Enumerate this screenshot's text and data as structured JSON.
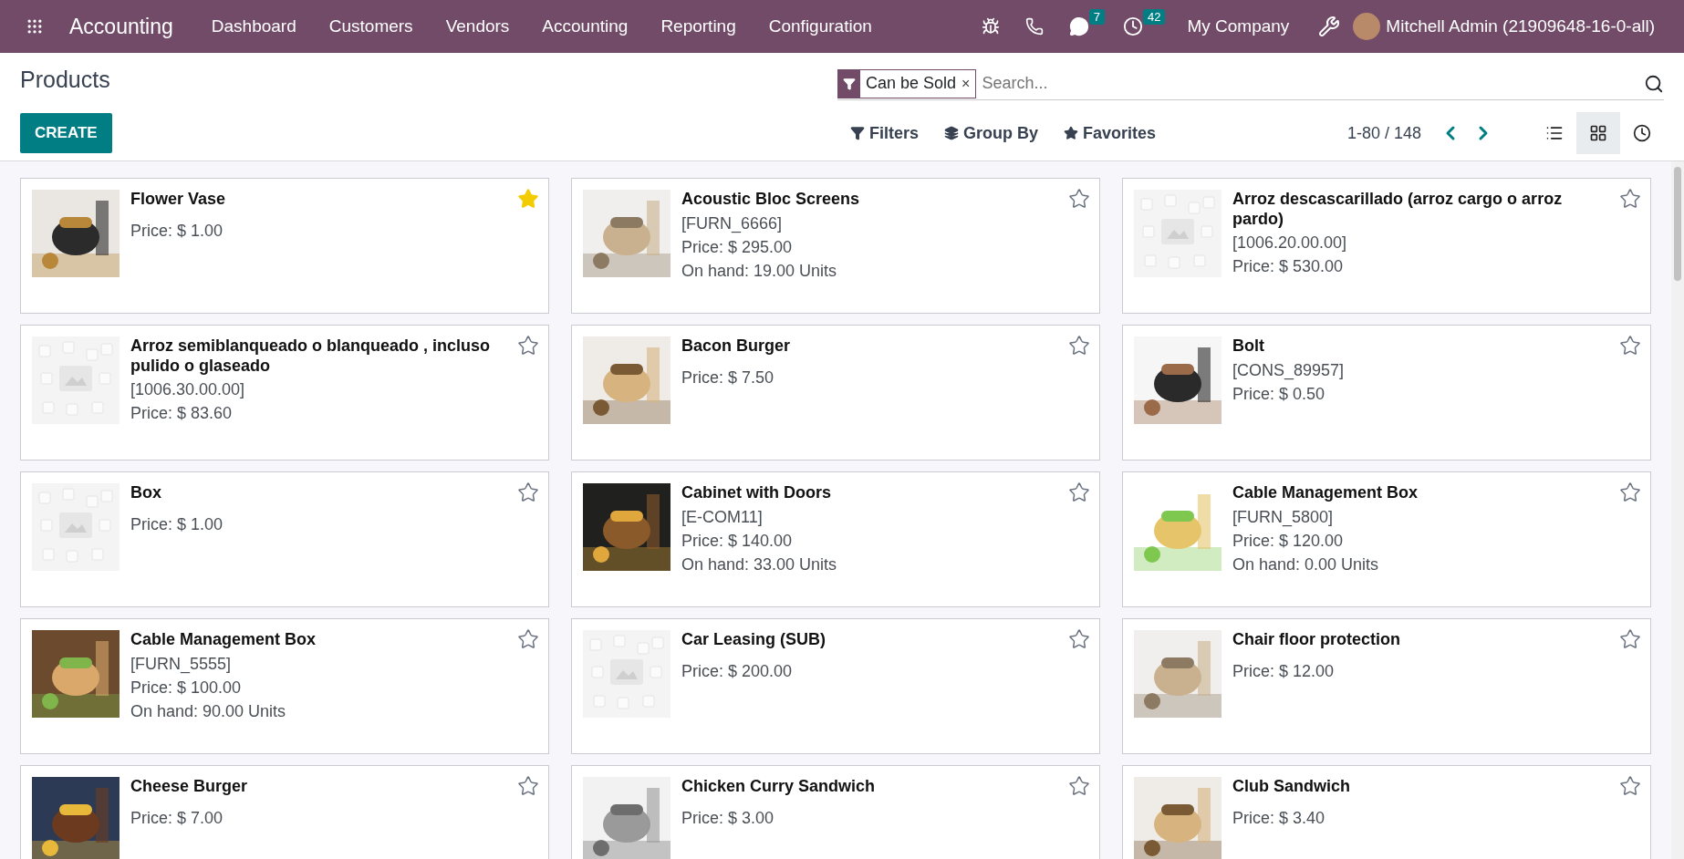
{
  "navbar": {
    "app_name": "Accounting",
    "menu": [
      "Dashboard",
      "Customers",
      "Vendors",
      "Accounting",
      "Reporting",
      "Configuration"
    ],
    "messages_badge": "7",
    "activities_badge": "42",
    "company": "My Company",
    "user": "Mitchell Admin (21909648-16-0-all)"
  },
  "control_panel": {
    "title": "Products",
    "create_label": "CREATE",
    "facet": {
      "label": "Can be Sold",
      "remove": "×"
    },
    "search": {
      "placeholder": "Search..."
    },
    "filters": [
      "Filters",
      "Group By",
      "Favorites"
    ],
    "pager": "1-80 / 148",
    "views": [
      {
        "kind": "list",
        "selected": false
      },
      {
        "kind": "kanban",
        "selected": true
      },
      {
        "kind": "activity",
        "selected": false
      }
    ]
  },
  "cards": [
    {
      "name": "Flower Vase",
      "price": "Price: $ 1.00",
      "favorite": true
    },
    {
      "name": "Acoustic Bloc Screens",
      "ref": "[FURN_6666]",
      "price": "Price: $ 295.00",
      "on_hand": "On hand: 19.00 Units",
      "favorite": false
    },
    {
      "name": "Arroz descascarillado (arroz cargo o arroz pardo)",
      "ref": "[1006.20.00.00]",
      "price": "Price: $ 530.00",
      "favorite": false,
      "image": {
        "kind": "placeholder"
      }
    },
    {
      "name": "Arroz semiblanqueado o blanqueado , incluso pulido o glaseado",
      "ref": "[1006.30.00.00]",
      "price": "Price: $ 83.60",
      "favorite": false,
      "image": {
        "kind": "placeholder"
      }
    },
    {
      "name": "Bacon Burger",
      "price": "Price: $ 7.50",
      "favorite": false
    },
    {
      "name": "Bolt",
      "ref": "[CONS_89957]",
      "price": "Price: $ 0.50",
      "favorite": false
    },
    {
      "name": "Box",
      "price": "Price: $ 1.00",
      "favorite": false,
      "image": {
        "kind": "placeholder"
      }
    },
    {
      "name": "Cabinet with Doors",
      "ref": "[E-COM11]",
      "price": "Price: $ 140.00",
      "on_hand": "On hand: 33.00 Units",
      "favorite": false
    },
    {
      "name": "Cable Management Box",
      "ref": "[FURN_5800]",
      "price": "Price: $ 120.00",
      "on_hand": "On hand: 0.00 Units",
      "favorite": false
    },
    {
      "name": "Cable Management Box",
      "ref": "[FURN_5555]",
      "price": "Price: $ 100.00",
      "on_hand": "On hand: 90.00 Units",
      "favorite": false
    },
    {
      "name": "Car Leasing (SUB)",
      "price": "Price: $ 200.00",
      "favorite": false,
      "image": {
        "kind": "placeholder"
      }
    },
    {
      "name": "Chair floor protection",
      "price": "Price: $ 12.00",
      "favorite": false
    },
    {
      "name": "Cheese Burger",
      "price": "Price: $ 7.00",
      "favorite": false
    },
    {
      "name": "Chicken Curry Sandwich",
      "price": "Price: $ 3.00",
      "favorite": false
    },
    {
      "name": "Club Sandwich",
      "price": "Price: $ 3.40",
      "favorite": false
    }
  ]
}
